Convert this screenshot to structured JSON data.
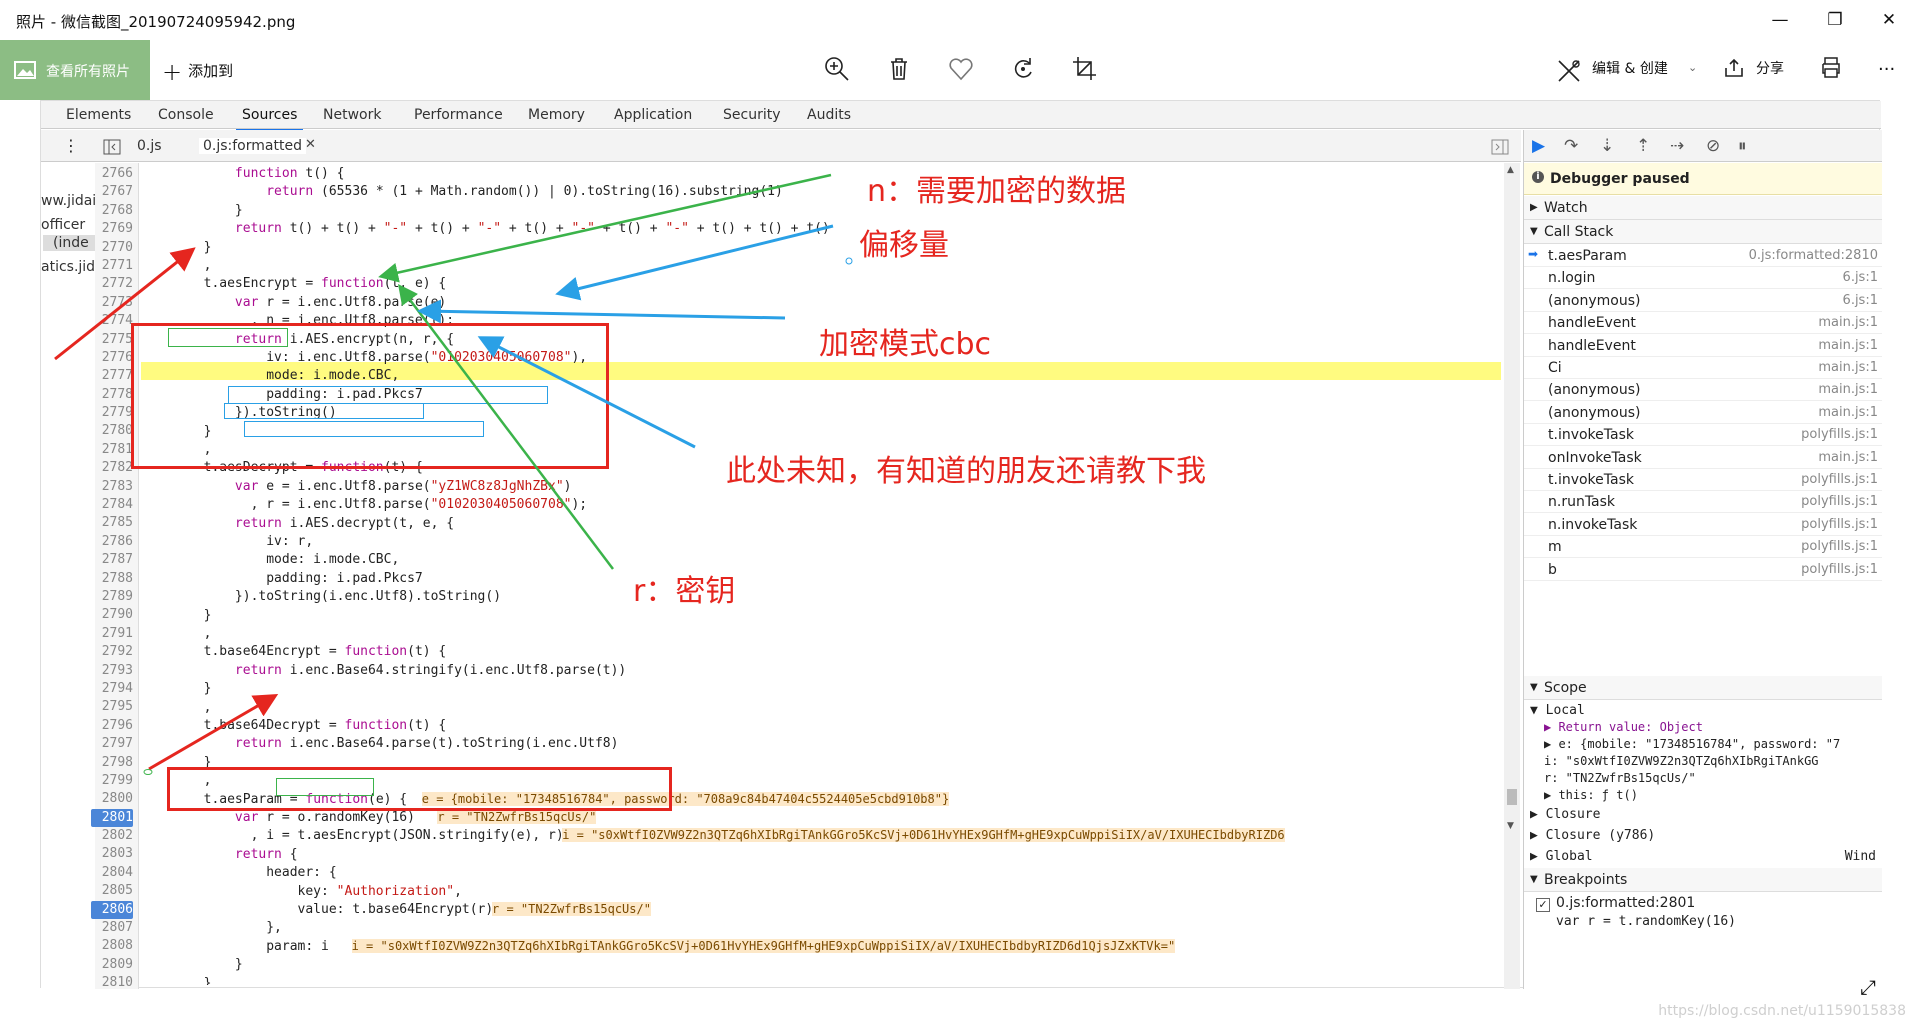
{
  "window": {
    "title": "照片 - 微信截图_20190724095942.png",
    "minimize": "—",
    "maximize": "❐",
    "close": "✕"
  },
  "toolbar": {
    "all_photos": "查看所有照片",
    "add_to": "添加到",
    "edit_create": "编辑 & 创建",
    "share": "分享",
    "more": "..."
  },
  "devtools": {
    "tabs": [
      "Elements",
      "Console",
      "Sources",
      "Network",
      "Performance",
      "Memory",
      "Application",
      "Security",
      "Audits"
    ],
    "active_tab": "Sources",
    "file_tabs": [
      "0.js",
      "0.js:formatted"
    ],
    "left_files": [
      "ww.jidai",
      "officer",
      "(inde",
      "atics.jida"
    ]
  },
  "code": {
    "line_numbers": [
      "2766",
      "2767",
      "2768",
      "2769",
      "2770",
      "2771",
      "2772",
      "2773",
      "2774",
      "2775",
      "2776",
      "2777",
      "2778",
      "2779",
      "2780",
      "2781",
      "2782",
      "2783",
      "2784",
      "2785",
      "2786",
      "2787",
      "2788",
      "2789",
      "2790",
      "2791",
      "2792",
      "2793",
      "2794",
      "2795",
      "2796",
      "2797",
      "2798",
      "2799",
      "2800",
      "2801",
      "2802",
      "2803",
      "2804",
      "2805",
      "2806",
      "2807",
      "2808",
      "2809",
      "2810"
    ],
    "breakpoint_lines": [
      "2801",
      "2806"
    ],
    "lines": [
      "            function t() {",
      "                return (65536 * (1 + Math.random()) | 0).toString(16).substring(1)",
      "            }",
      "            return t() + t() + \"-\" + t() + \"-\" + t() + \"-\" + t() + \"-\" + t() + t() + t()",
      "        }",
      "        ,",
      "        t.aesEncrypt = function(t, e) {",
      "            var r = i.enc.Utf8.parse(e)",
      "              , n = i.enc.Utf8.parse(t);",
      "            return i.AES.encrypt(n, r, {",
      "                iv: i.enc.Utf8.parse(\"0102030405060708\"),",
      "                mode: i.mode.CBC,",
      "                padding: i.pad.Pkcs7",
      "            }).toString()",
      "        }",
      "        ,",
      "        t.aesDecrypt = function(t) {",
      "            var e = i.enc.Utf8.parse(\"yZ1WC8z8JgNhZBx\")",
      "              , r = i.enc.Utf8.parse(\"0102030405060708\");",
      "            return i.AES.decrypt(t, e, {",
      "                iv: r,",
      "                mode: i.mode.CBC,",
      "                padding: i.pad.Pkcs7",
      "            }).toString(i.enc.Utf8).toString()",
      "        }",
      "        ,",
      "        t.base64Encrypt = function(t) {",
      "            return i.enc.Base64.stringify(i.enc.Utf8.parse(t))",
      "        }",
      "        ,",
      "        t.base64Decrypt = function(t) {",
      "            return i.enc.Base64.parse(t).toString(i.enc.Utf8)",
      "        }",
      "        ,",
      "        t.aesParam = function(e) {  ",
      "            var r = o.randomKey(16)",
      "              , i = t.aesEncrypt(JSON.stringify(e), r);",
      "            return {",
      "                header: {",
      "                    key: \"Authorization\",",
      "                    value: t.base64Encrypt(r)  ",
      "                },",
      "                param: i  ",
      "            }",
      "        }"
    ],
    "inline_values": {
      "e": "e = {mobile: \"17348516784\", password: \"708a9c84b47404c5524405e5cbd910b8\"}",
      "r1": "r = \"TN2ZwfrBs15qcUs/\"",
      "i1": "i = \"s0xWtfI0ZVW9Z2n3QTZq6hXIbRgiTAnkGGro5KcSVj+0D61HvYHEx9GHfM+gHE9xpCuWppiSiIX/aV/IXUHECIbdbyRIZD6",
      "r2": "r = \"TN2ZwfrBs15qcUs/\"",
      "i2": "i = \"s0xWtfI0ZVW9Z2n3QTZq6hXIbRgiTAnkGGro5KcSVj+0D61HvYHEx9GHfM+gHE9xpCuWppiSiIX/aV/IXUHECIbdbyRIZD6d1QjsJZxKTVk=\""
    }
  },
  "debugger": {
    "paused": "Debugger paused",
    "watch": "Watch",
    "call_stack": "Call Stack",
    "frames": [
      {
        "fn": "t.aesParam",
        "loc": "0.js:formatted:2810"
      },
      {
        "fn": "n.login",
        "loc": "6.js:1"
      },
      {
        "fn": "(anonymous)",
        "loc": "6.js:1"
      },
      {
        "fn": "handleEvent",
        "loc": "main.js:1"
      },
      {
        "fn": "handleEvent",
        "loc": "main.js:1"
      },
      {
        "fn": "Ci",
        "loc": "main.js:1"
      },
      {
        "fn": "(anonymous)",
        "loc": "main.js:1"
      },
      {
        "fn": "(anonymous)",
        "loc": "main.js:1"
      },
      {
        "fn": "t.invokeTask",
        "loc": "polyfills.js:1"
      },
      {
        "fn": "onInvokeTask",
        "loc": "main.js:1"
      },
      {
        "fn": "t.invokeTask",
        "loc": "polyfills.js:1"
      },
      {
        "fn": "n.runTask",
        "loc": "polyfills.js:1"
      },
      {
        "fn": "n.invokeTask",
        "loc": "polyfills.js:1"
      },
      {
        "fn": "m",
        "loc": "polyfills.js:1"
      },
      {
        "fn": "b",
        "loc": "polyfills.js:1"
      }
    ],
    "scope": "Scope",
    "local": "Local",
    "scope_lines": [
      "▶ Return value: Object",
      "▶ e: {mobile: \"17348516784\", password: \"7",
      "   i: \"s0xWtfI0ZVW9Z2n3QTZq6hXIbRgiTAnkGG",
      "   r: \"TN2ZwfrBs15qcUs/\"",
      "▶ this: ƒ t()"
    ],
    "closure": "Closure",
    "closure2": "Closure (y786)",
    "global": "Global",
    "global_val": "Wind",
    "breakpoints": "Breakpoints",
    "bp_file": "0.js:formatted:2801",
    "bp_code": "var r = t.randomKey(16)"
  },
  "annotations": {
    "n": "n：需要加密的数据",
    "offset": "偏移量",
    "cbc": "加密模式cbc",
    "unknown": "此处未知，有知道的朋友还请教下我",
    "r": "r：密钥"
  },
  "watermark": "https://blog.csdn.net/u1159015838",
  "colors": {
    "accent": "#1a73e8",
    "annotation_red": "#e5261f",
    "annotation_green": "#3bb34a",
    "annotation_blue": "#2aa0e6",
    "sidebar_green": "#8cbd84"
  }
}
